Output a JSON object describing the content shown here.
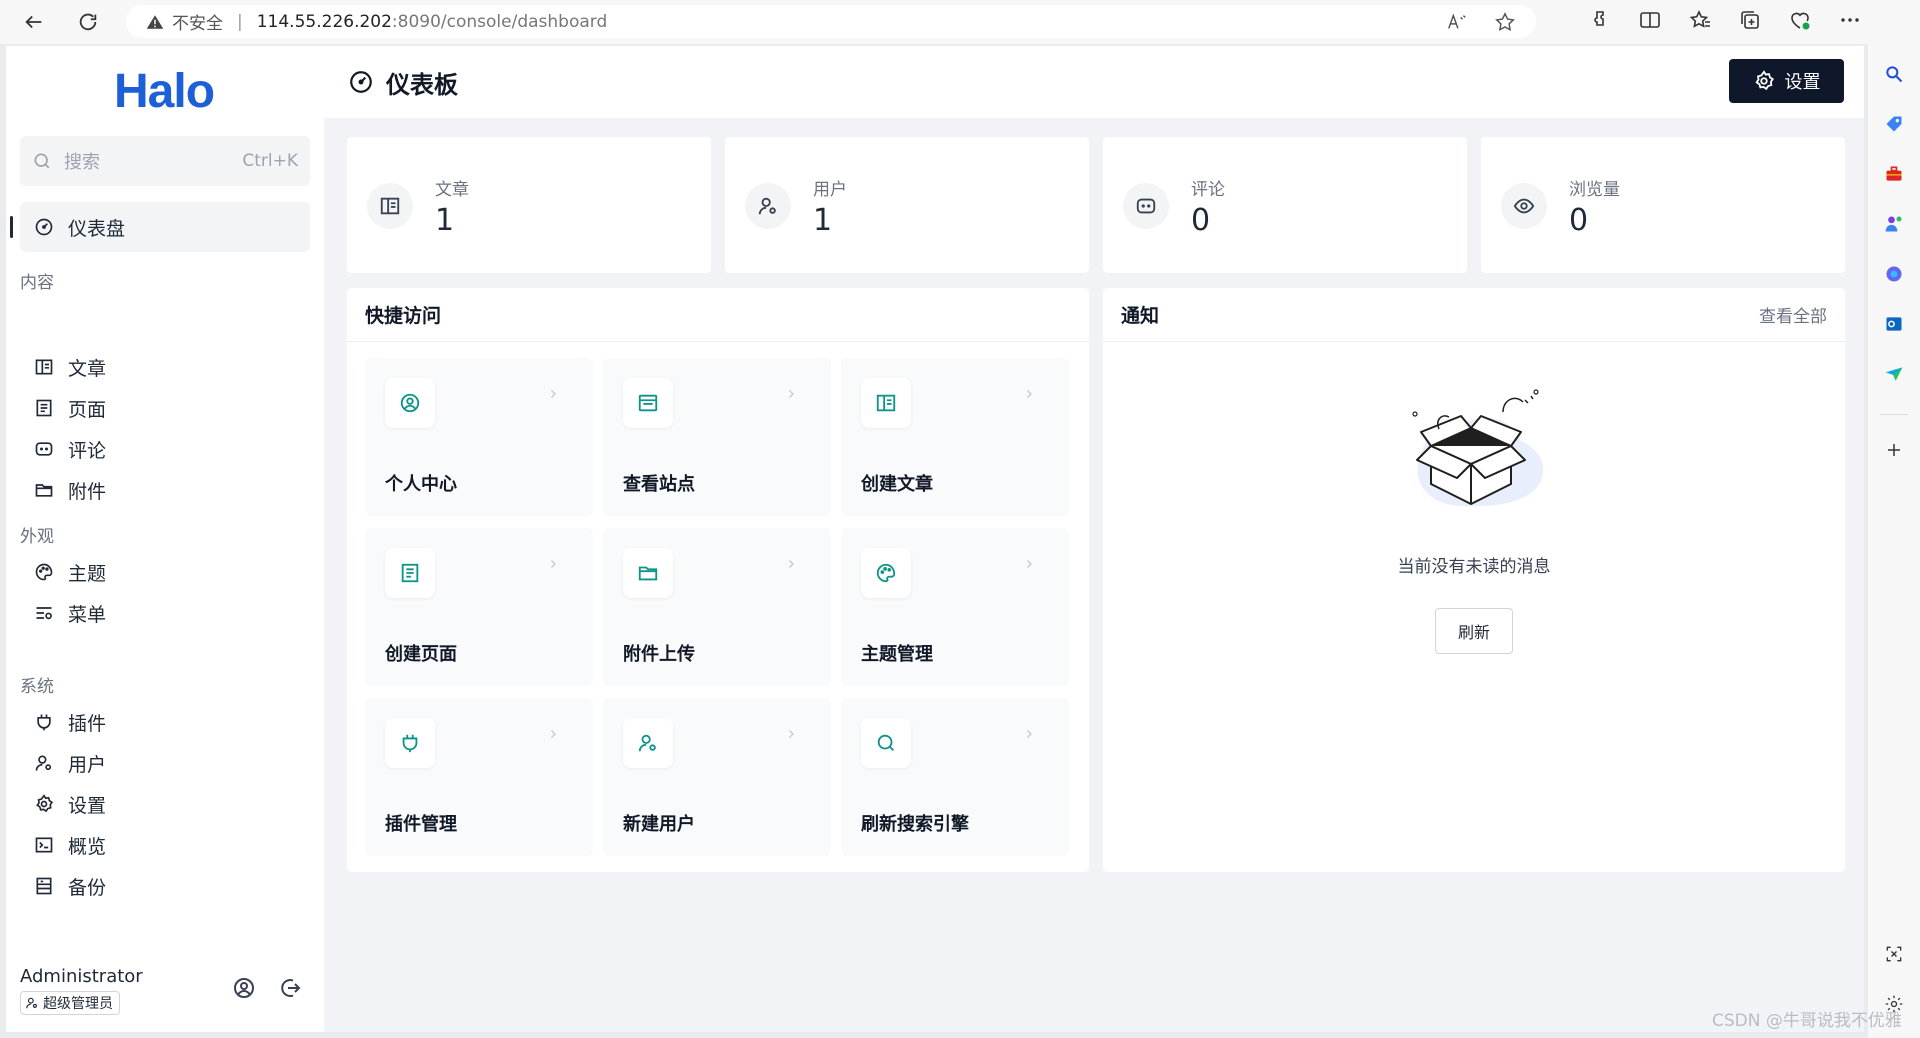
{
  "browser": {
    "address_insecure": "不安全",
    "address_host": "114.55.226.202",
    "address_path": ":8090/console/dashboard"
  },
  "sidebar": {
    "logo": "Halo",
    "search_placeholder": "搜索",
    "search_shortcut": "Ctrl+K",
    "active_item": "仪表盘",
    "groups": [
      {
        "title": "内容",
        "items": [
          "文章",
          "页面",
          "评论",
          "附件"
        ]
      },
      {
        "title": "外观",
        "items": [
          "主题",
          "菜单"
        ]
      },
      {
        "title": "系统",
        "items": [
          "插件",
          "用户",
          "设置",
          "概览",
          "备份"
        ]
      }
    ],
    "user_name": "Administrator",
    "user_role": "超级管理员"
  },
  "header": {
    "title": "仪表板",
    "settings_label": "设置"
  },
  "stats": [
    {
      "label": "文章",
      "value": "1",
      "icon": "article-icon"
    },
    {
      "label": "用户",
      "value": "1",
      "icon": "user-icon"
    },
    {
      "label": "评论",
      "value": "0",
      "icon": "comment-icon"
    },
    {
      "label": "浏览量",
      "value": "0",
      "icon": "eye-icon"
    }
  ],
  "quick_access": {
    "title": "快捷访问",
    "items": [
      "个人中心",
      "查看站点",
      "创建文章",
      "创建页面",
      "附件上传",
      "主题管理",
      "插件管理",
      "新建用户",
      "刷新搜索引擎"
    ]
  },
  "notifications": {
    "title": "通知",
    "view_all": "查看全部",
    "empty_message": "当前没有未读的消息",
    "refresh_label": "刷新"
  },
  "watermark": "CSDN @牛哥说我不优雅",
  "colors": {
    "accent": "#0f172a",
    "brand": "#1d5fd6",
    "quick_icon": "#0d9488"
  }
}
